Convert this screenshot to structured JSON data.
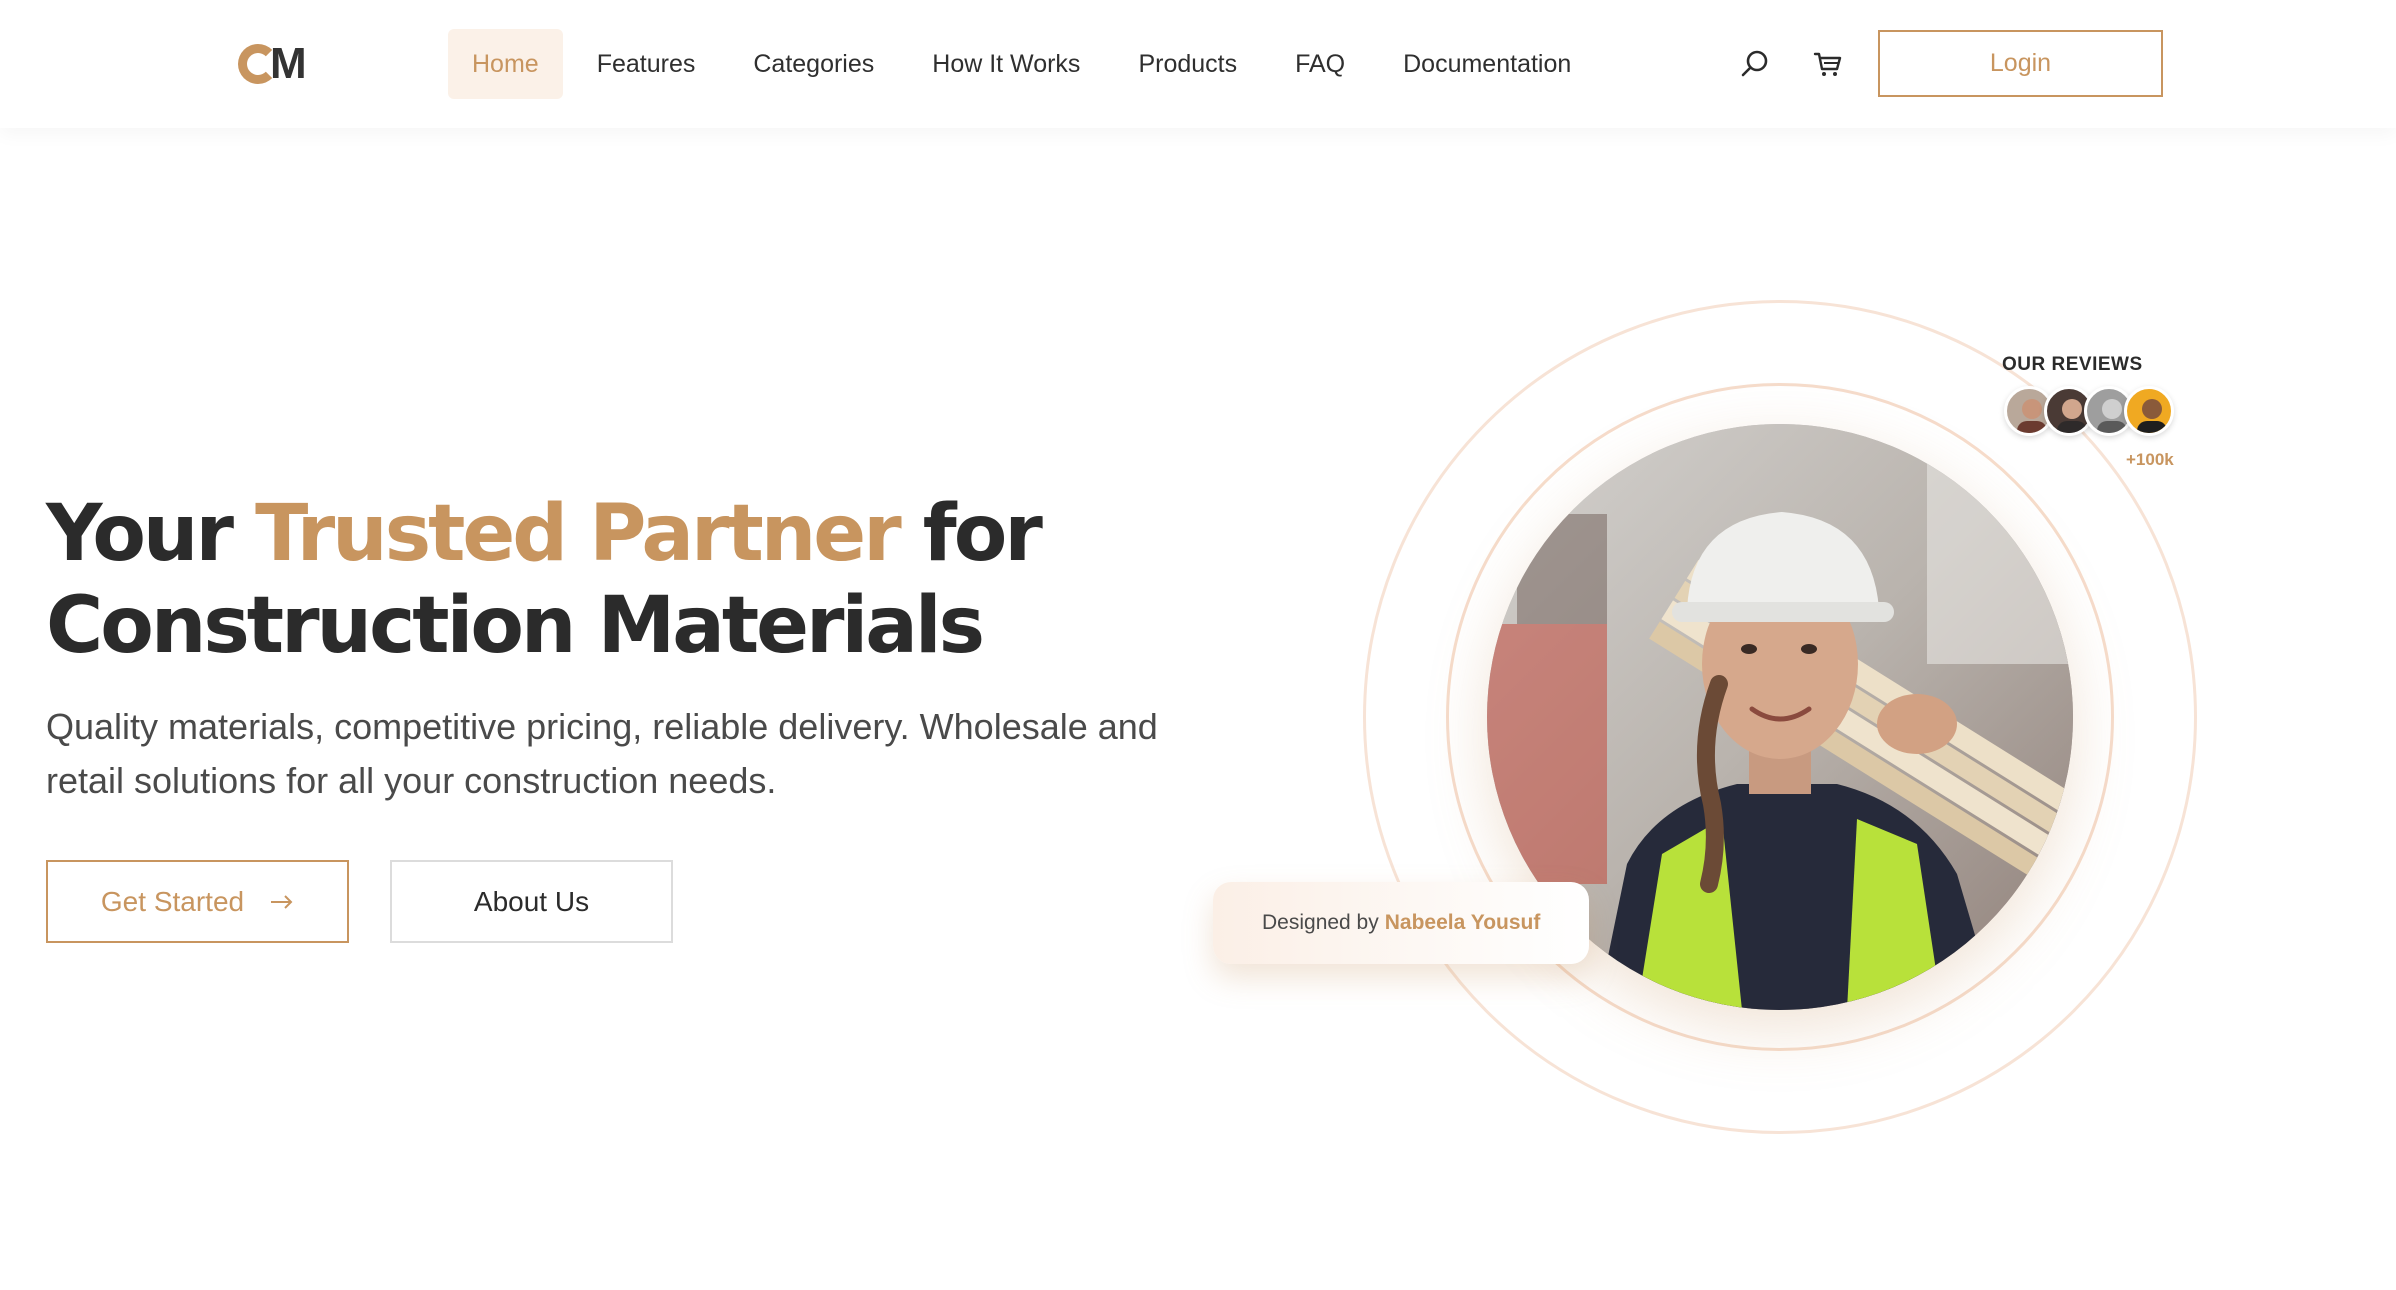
{
  "brand": {
    "logo_letters": "CM",
    "accent_color": "#c8955f",
    "text_color": "#2b2b2b"
  },
  "nav": {
    "items": [
      {
        "label": "Home",
        "active": true
      },
      {
        "label": "Features",
        "active": false
      },
      {
        "label": "Categories",
        "active": false
      },
      {
        "label": "How It Works",
        "active": false
      },
      {
        "label": "Products",
        "active": false
      },
      {
        "label": "FAQ",
        "active": false
      },
      {
        "label": "Documentation",
        "active": false
      }
    ],
    "search_icon": "search-icon",
    "cart_icon": "cart-icon",
    "login_label": "Login"
  },
  "hero": {
    "title_part1": "Your ",
    "title_accent": "Trusted Partner",
    "title_part2": " for",
    "title_line2": "Construction Materials",
    "subtitle": "Quality materials, competitive pricing, reliable delivery. Wholesale and retail solutions for all your construction needs.",
    "primary_button": "Get Started",
    "primary_button_icon": "arrow-right-icon",
    "secondary_button": "About Us"
  },
  "reviews": {
    "label": "OUR REVIEWS",
    "count": "+100k"
  },
  "credit": {
    "prefix": "Designed by",
    "name": "Nabeela Yousuf"
  }
}
